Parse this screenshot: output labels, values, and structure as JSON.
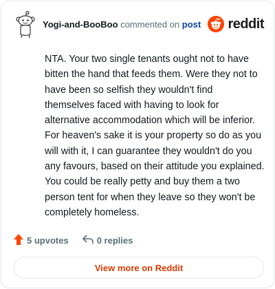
{
  "header": {
    "username": "Yogi-and-BooBoo",
    "action_text": "commented on",
    "target_link": "post",
    "brand_name": "reddit"
  },
  "comment": {
    "body": "NTA. Your two single tenants ought not to have bitten the hand that feeds them. Were they not to have been so selfish they wouldn't find themselves faced with having to look for alternative accommodation which will be inferior. For heaven's sake it is your property so do as you will with it, I can guarantee they wouldn't do you any favours, based on their attitude you explained. You could be really petty and buy them a two person tent for when they leave so they won't be completely homeless."
  },
  "actions": {
    "upvotes_label": "5 upvotes",
    "replies_label": "0 replies"
  },
  "footer": {
    "view_more_label": "View more on Reddit"
  },
  "icons": {
    "avatar": "snoo-avatar-icon",
    "brand": "reddit-logo-icon",
    "upvote": "upvote-arrow-icon",
    "reply": "reply-arrow-icon"
  },
  "colors": {
    "brand_orange": "#ff4500",
    "upvote": "#ff4500",
    "link": "#0a449b",
    "view_more_text": "#d93a00",
    "muted": "#576f76",
    "border": "#e5e7eb"
  }
}
